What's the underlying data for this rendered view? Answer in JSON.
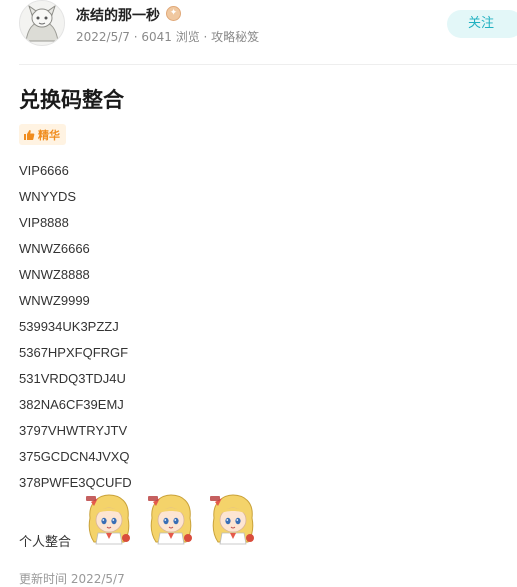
{
  "author": {
    "name": "冻结的那一秒",
    "badge_icon": "gold-medal-icon",
    "meta": "2022/5/7 · 6041 浏览 · 攻略秘笈"
  },
  "follow_button": {
    "label": "关注"
  },
  "article": {
    "title": "兑换码整合",
    "tag_label": "精华",
    "codes": [
      "VIP6666",
      "WNYYDS",
      "VIP8888",
      "WNWZ6666",
      "WNWZ8888",
      "WNWZ9999",
      "539934UK3PZZJ",
      "5367HPXFQFRGF",
      "531VRDQ3TDJ4U",
      "382NA6CF39EMJ",
      "3797VHWTRYJTV",
      "375GCDCN4JVXQ",
      "378PWFE3QCUFD"
    ],
    "closing_text": "个人整合",
    "sticker_icon": "anime-girl-sticker-icon",
    "updated": "更新时间 2022/5/7"
  },
  "colors": {
    "accent": "#22b1c1",
    "follow_bg": "#e3f7f8",
    "tag_text": "#f08c1e",
    "tag_bg": "#fff3e2",
    "meta_text": "#8a8a8a"
  }
}
